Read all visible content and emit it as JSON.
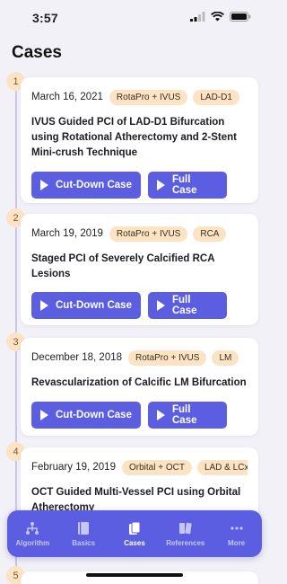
{
  "status": {
    "time": "3:57"
  },
  "page": {
    "title": "Cases"
  },
  "cases": [
    {
      "number": "1",
      "date": "March 16, 2021",
      "tags": [
        "RotaPro + IVUS",
        "LAD-D1"
      ],
      "title": "IVUS Guided PCI of LAD-D1 Bifurcation using Rotational Atherectomy and 2-Stent Mini-crush Technique"
    },
    {
      "number": "2",
      "date": "March 19, 2019",
      "tags": [
        "RotaPro + IVUS",
        "RCA"
      ],
      "title": "Staged PCI of Severely Calcified RCA Lesions"
    },
    {
      "number": "3",
      "date": "December 18, 2018",
      "tags": [
        "RotaPro + IVUS",
        "LM"
      ],
      "title": "Revascularization of Calcific LM Bifurcation"
    },
    {
      "number": "4",
      "date": "February 19, 2019",
      "tags": [
        "Orbital + OCT",
        "LAD & LCx"
      ],
      "title": "OCT Guided Multi-Vessel PCI using Orbital Atherectomy"
    },
    {
      "number": "5"
    }
  ],
  "buttons": {
    "cut_down": "Cut-Down Case",
    "full": "Full Case"
  },
  "tabs": [
    {
      "label": "Algorithm",
      "icon": "algorithm-icon"
    },
    {
      "label": "Basics",
      "icon": "book-icon"
    },
    {
      "label": "Cases",
      "icon": "cases-icon",
      "active": true
    },
    {
      "label": "References",
      "icon": "references-icon"
    },
    {
      "label": "More",
      "icon": "more-icon"
    }
  ],
  "colors": {
    "accent": "#5b5ee0",
    "tag_bg": "#fbe3c4",
    "timeline": "#c9c3ee"
  }
}
